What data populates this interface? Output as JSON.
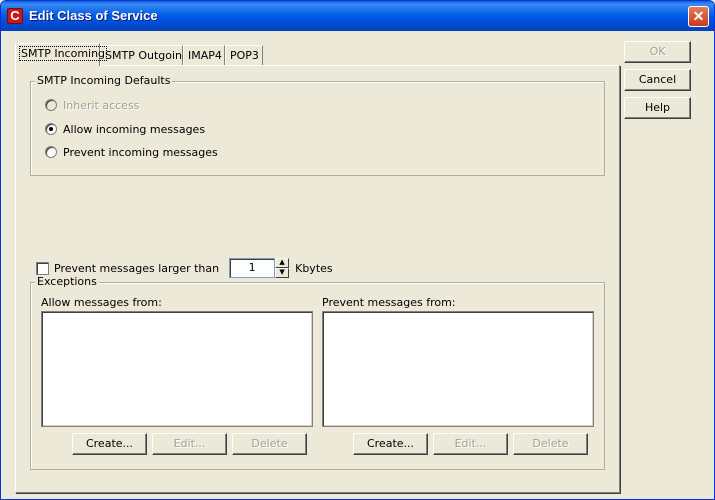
{
  "window": {
    "title": "Edit Class of Service"
  },
  "tabs": [
    {
      "label": "SMTP Incoming"
    },
    {
      "label": "SMTP Outgoing"
    },
    {
      "label": "IMAP4"
    },
    {
      "label": "POP3"
    }
  ],
  "defaults_group": {
    "legend": "SMTP Incoming Defaults",
    "options": [
      {
        "label": "Inherit access"
      },
      {
        "label": "Allow incoming messages"
      },
      {
        "label": "Prevent incoming messages"
      }
    ],
    "selected": "Allow incoming messages"
  },
  "size_limit": {
    "label": "Prevent messages larger than",
    "value": "1",
    "unit": "Kbytes",
    "checked": false
  },
  "exceptions": {
    "legend": "Exceptions",
    "allow": {
      "label": "Allow messages from:",
      "create": "Create...",
      "edit": "Edit...",
      "delete": "Delete"
    },
    "prevent": {
      "label": "Prevent messages from:",
      "create": "Create...",
      "edit": "Edit...",
      "delete": "Delete"
    }
  },
  "side_buttons": {
    "ok": "OK",
    "cancel": "Cancel",
    "help": "Help"
  }
}
